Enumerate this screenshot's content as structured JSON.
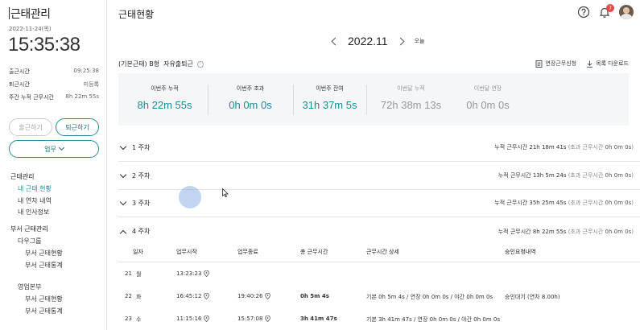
{
  "sidebar": {
    "title": "근태관리",
    "date": "2022-11-24(목)",
    "clock": "15:35:38",
    "stats": [
      {
        "label": "출근시간",
        "value": "09:25:38"
      },
      {
        "label": "퇴근시간",
        "value": "미등록"
      },
      {
        "label": "주간 누적 근무시간",
        "value": "8h 22m 55s"
      }
    ],
    "check_in_label": "출근하기",
    "check_out_label": "퇴근하기",
    "work_label": "업무",
    "menu": {
      "section1": "근태관리",
      "my_status": "내 근태 현황",
      "my_leave": "내 연차 내역",
      "my_info": "내 인사정보",
      "section2": "부서 근태관리",
      "group1": "다우그룹",
      "group1_status": "부서 근태현황",
      "group1_stats": "부서 근태통계",
      "group2": "영업본부",
      "group2_status": "부서 근태현황",
      "group2_stats": "부서 근태통계"
    }
  },
  "header": {
    "page_title": "근태현황",
    "notification_count": "7",
    "month": "2022.11",
    "today_label": "오늘"
  },
  "policy": {
    "type_label": "(기본근태) B형",
    "sub_label": "자유출퇴근",
    "overtime_request": "연장근무신청",
    "list_download": "목록 다운로드"
  },
  "summary": [
    {
      "label": "이번주 누적",
      "value": "8h 22m 55s",
      "muted": false
    },
    {
      "label": "이번주 초과",
      "value": "0h 0m 0s",
      "muted": false
    },
    {
      "label": "이번주 잔여",
      "value": "31h 37m 5s",
      "muted": false
    },
    {
      "label": "이번달 누적",
      "value": "72h 38m 13s",
      "muted": true
    },
    {
      "label": "이번달 연장",
      "value": "0h 0m 0s",
      "muted": true
    }
  ],
  "weeks": [
    {
      "label": "1 주차",
      "total_prefix": "누적 근무시간",
      "total": "21h 18m 41s",
      "sub_prefix": "(초과 근무시간",
      "sub_value": "0h 0m 0s",
      "sub_suffix": ")"
    },
    {
      "label": "2 주차",
      "total_prefix": "누적 근무시간",
      "total": "13h 5m 24s",
      "sub_prefix": "(초과 근무시간",
      "sub_value": "0h 0m 0s",
      "sub_suffix": ")"
    },
    {
      "label": "3 주차",
      "total_prefix": "누적 근무시간",
      "total": "35h 25m 45s",
      "sub_prefix": "(초과 근무시간",
      "sub_value": "0h 0m 0s",
      "sub_suffix": ")"
    },
    {
      "label": "4 주차",
      "total_prefix": "누적 근무시간",
      "total": "8h 22m 55s",
      "sub_prefix": "(초과 근무시간",
      "sub_value": "0h 0m 0s",
      "sub_suffix": ")"
    }
  ],
  "table": {
    "headers": [
      "일자",
      "업무시작",
      "업무종료",
      "총 근무시간",
      "근무시간 상세",
      "승인요청내역"
    ],
    "rows": [
      {
        "day": "21",
        "dow": "월",
        "start": "13:23:23",
        "end": "",
        "total": "",
        "detail": "",
        "approval": ""
      },
      {
        "day": "22",
        "dow": "화",
        "start": "16:45:12",
        "end": "19:40:26",
        "total": "0h 5m 4s",
        "detail": "기본 0h 5m 4s / 연장 0h 0m 0s / 야간 0h 0m 0s",
        "approval": "승인대기 (연차 8.00h)"
      },
      {
        "day": "23",
        "dow": "수",
        "start": "11:15:16",
        "end": "15:57:08",
        "total": "3h 41m 47s",
        "detail": "기본 3h 41m 47s / 연장 0h 0m 0s / 야간 0h 0m 0s",
        "approval": ""
      }
    ]
  },
  "colors": {
    "accent": "#1f8a96",
    "badge": "#e34a4a"
  }
}
